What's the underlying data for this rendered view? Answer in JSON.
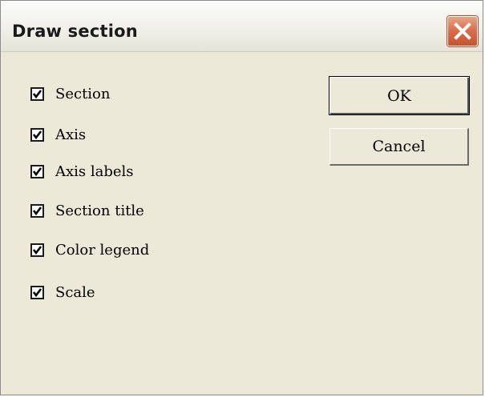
{
  "window": {
    "title": "Draw section",
    "close_icon": "close-icon"
  },
  "options": [
    {
      "label": "Section",
      "checked": true
    },
    {
      "label": "Axis",
      "checked": true
    },
    {
      "label": "Axis labels",
      "checked": true
    },
    {
      "label": "Section title",
      "checked": true
    },
    {
      "label": "Color legend",
      "checked": true
    },
    {
      "label": "Scale",
      "checked": true
    }
  ],
  "buttons": {
    "ok_label": "OK",
    "cancel_label": "Cancel"
  },
  "colors": {
    "dialog_background": "#ece9d8",
    "close_button": "#d9704e"
  }
}
